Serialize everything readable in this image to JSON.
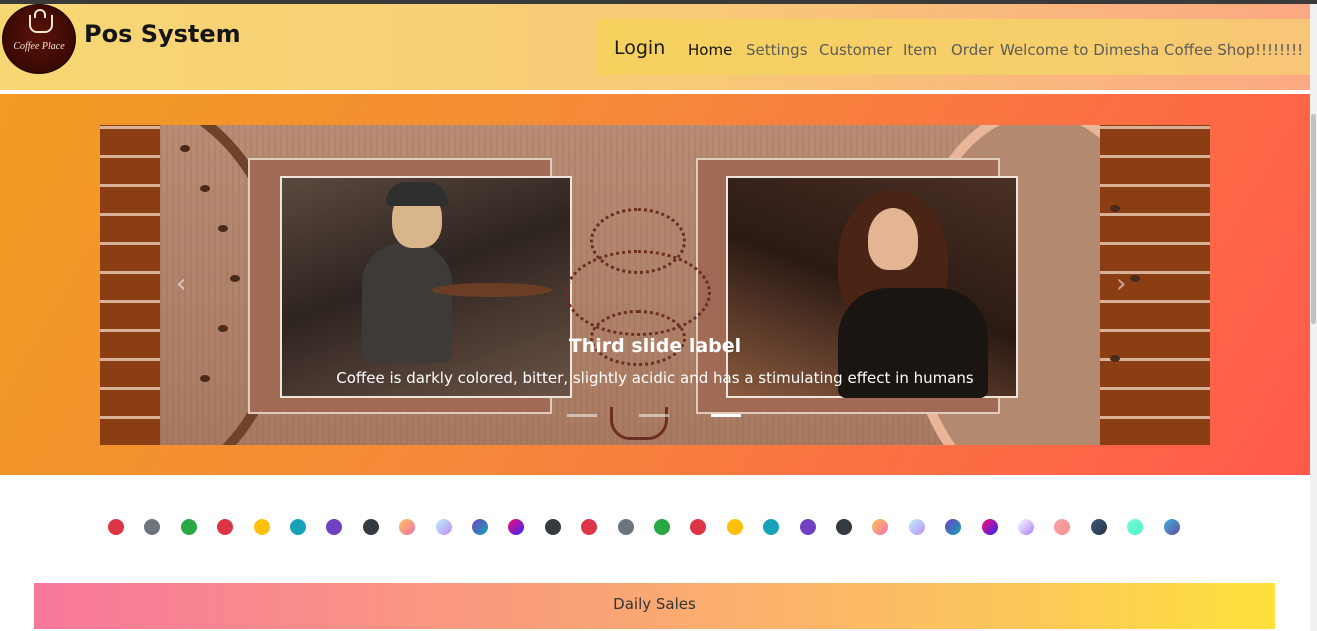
{
  "header": {
    "logo_text": "Coffee Place",
    "brand": "Pos System"
  },
  "nav": {
    "login": "Login",
    "items": [
      {
        "label": "Home",
        "active": true
      },
      {
        "label": "Settings",
        "active": false
      },
      {
        "label": "Customer",
        "active": false
      },
      {
        "label": "Item",
        "active": false
      },
      {
        "label": "Order",
        "active": false
      }
    ],
    "welcome": "Welcome to Dimesha Coffee Shop!!!!!!!!"
  },
  "carousel": {
    "caption_title": "Third slide label",
    "caption_text": "Coffee is darkly colored, bitter, slightly acidic and has a stimulating effect in humans",
    "prev_icon": "chevron-left-icon",
    "next_icon": "chevron-right-icon",
    "prev_glyph": "‹",
    "next_glyph": "›",
    "slide_count": 3,
    "active_slide": 3
  },
  "color_dots": [
    "#dc3545",
    "#6c757d",
    "#28a745",
    "#dc3545",
    "#ffc107",
    "#17a2b8",
    "#6f42c1",
    "#343a40",
    "gradient:#fbc456,#f46fb1",
    "gradient:#b6f0f7,#c48df5",
    "gradient:#6f42c1,#17a2b8",
    "gradient:#ff0a6c,#2d27ff",
    "#343a40",
    "#dc3545",
    "#6c757d",
    "#28a745",
    "#dc3545",
    "#ffc107",
    "#17a2b8",
    "#6f42c1",
    "#343a40",
    "gradient:#fbc456,#f46fb1",
    "gradient:#b6f0f7,#c48df5",
    "gradient:#6f42c1,#17a2b8",
    "gradient:#ff0a6c,#2d27ff",
    "gradient:#ffffff,#a97ef4",
    "gradient:#f8a4a4,#fb8e8e",
    "gradient:#3d5a80,#293241",
    "gradient:#7ef9d2,#45f5c8",
    "gradient:#3bb6d8,#6b47a7"
  ],
  "daily_sales": {
    "label": "Daily Sales"
  }
}
